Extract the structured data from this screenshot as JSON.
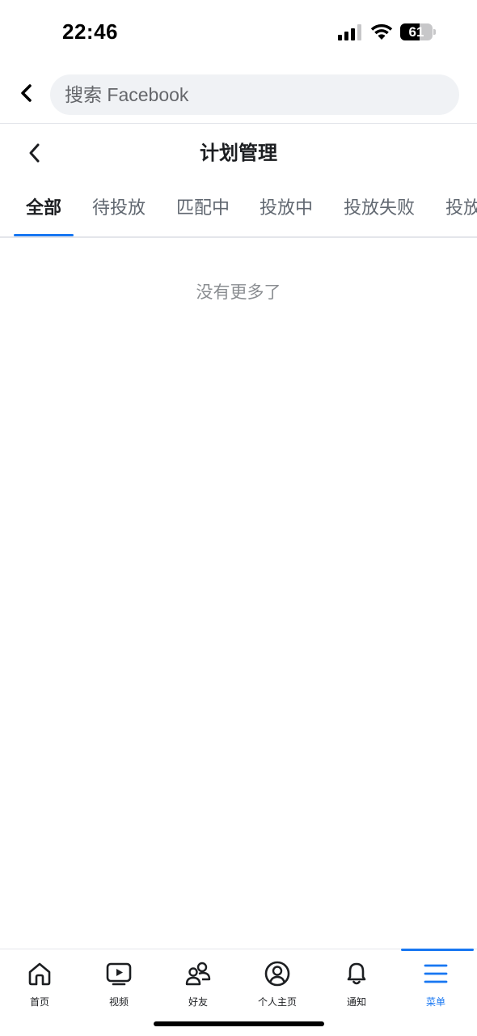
{
  "status_bar": {
    "time": "22:46",
    "battery_level": "61",
    "battery_fraction": 0.61,
    "icons": [
      "signal-icon",
      "wifi-icon",
      "battery-icon"
    ]
  },
  "search": {
    "placeholder": "搜索 Facebook",
    "back_icon": "chevron-left-icon"
  },
  "page": {
    "title": "计划管理",
    "back_icon": "chevron-left-icon"
  },
  "tabs": [
    {
      "label": "全部",
      "active": true
    },
    {
      "label": "待投放",
      "active": false
    },
    {
      "label": "匹配中",
      "active": false
    },
    {
      "label": "投放中",
      "active": false
    },
    {
      "label": "投放失败",
      "active": false
    },
    {
      "label": "投放",
      "active": false
    }
  ],
  "empty_state": {
    "text": "没有更多了"
  },
  "bottom_nav": {
    "items": [
      {
        "label": "首页",
        "icon": "home-icon",
        "active": false
      },
      {
        "label": "视频",
        "icon": "video-icon",
        "active": false
      },
      {
        "label": "好友",
        "icon": "friends-icon",
        "active": false
      },
      {
        "label": "个人主页",
        "icon": "profile-icon",
        "active": false
      },
      {
        "label": "通知",
        "icon": "bell-icon",
        "active": false
      },
      {
        "label": "菜单",
        "icon": "menu-icon",
        "active": true
      }
    ]
  },
  "colors": {
    "accent": "#1877f2",
    "text_primary": "#1c1e21",
    "text_secondary": "#606770",
    "search_bg": "#f0f2f5"
  }
}
